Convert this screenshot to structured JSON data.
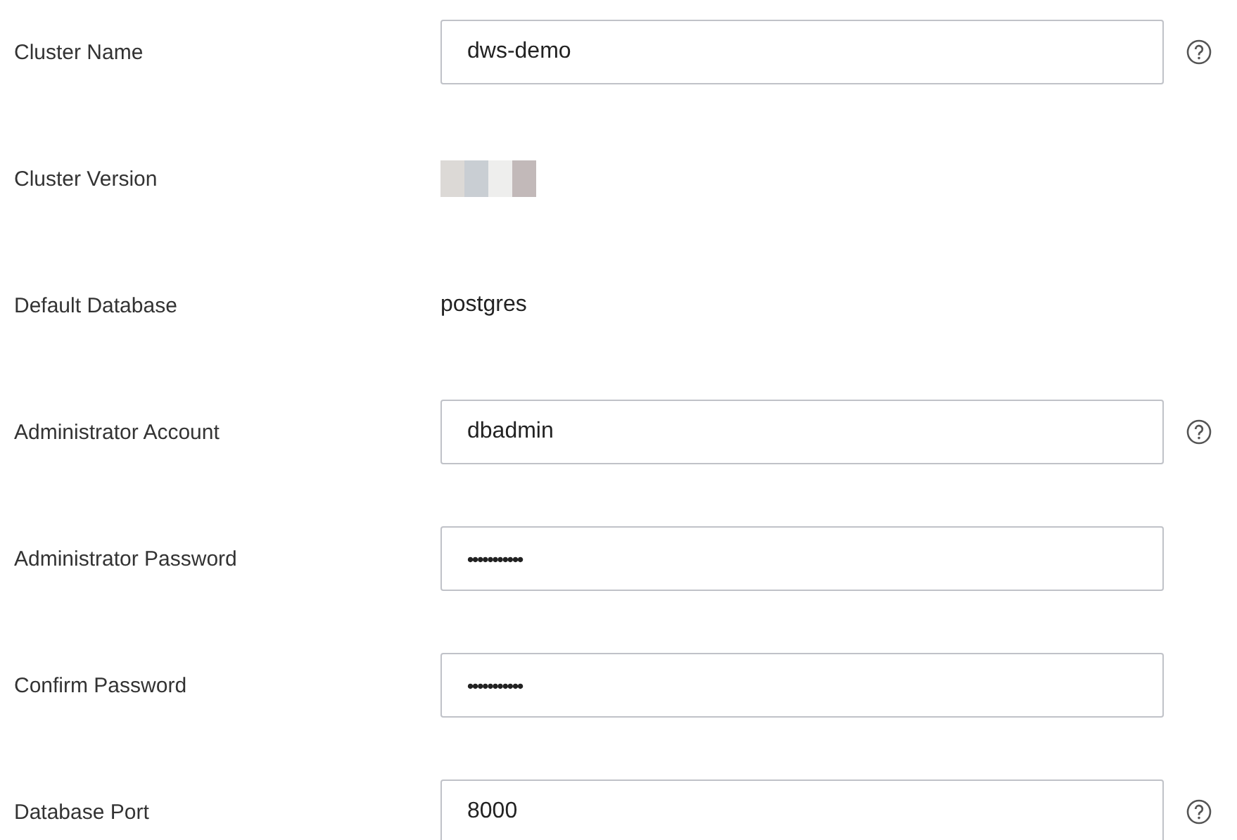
{
  "fields": [
    {
      "label": "Cluster Name",
      "kind": "input",
      "value": "dws-demo",
      "help": true
    },
    {
      "label": "Cluster Version",
      "kind": "redacted",
      "help": false
    },
    {
      "label": "Default Database",
      "kind": "text",
      "value": "postgres",
      "help": false
    },
    {
      "label": "Administrator Account",
      "kind": "input",
      "value": "dbadmin",
      "help": true
    },
    {
      "label": "Administrator Password",
      "kind": "password",
      "value": "•••••••••••",
      "help": false
    },
    {
      "label": "Confirm Password",
      "kind": "password",
      "value": "•••••••••••",
      "help": false
    },
    {
      "label": "Database Port",
      "kind": "input",
      "value": "8000",
      "help": true
    }
  ]
}
